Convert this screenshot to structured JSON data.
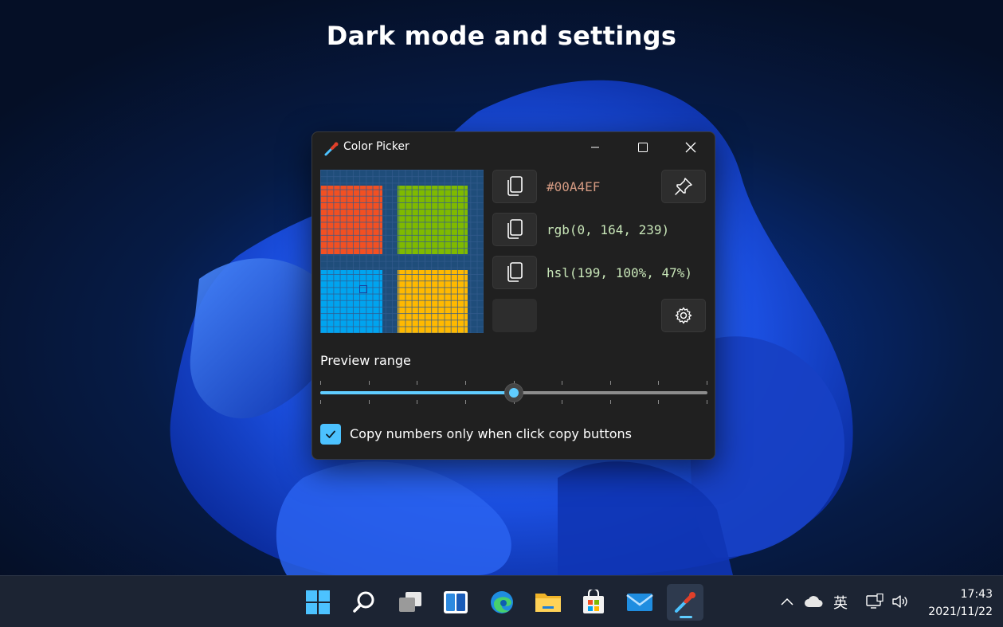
{
  "headline": "Dark mode and settings",
  "window": {
    "title": "Color Picker",
    "controls": {
      "minimize": "minimize",
      "maximize": "maximize",
      "close": "close"
    }
  },
  "colors": {
    "hex": "#00A4EF",
    "rgb": "rgb(0, 164, 239)",
    "hsl": "hsl(199, 100%, 47%)",
    "hex_text_color": "#d49a82",
    "value_text_color": "#c8e6b8",
    "accent": "#60cdff"
  },
  "preview": {
    "tile_colors": [
      "#f25022",
      "#7fba00",
      "#00a4ef",
      "#ffb900"
    ]
  },
  "preview_range": {
    "label": "Preview range",
    "value_fraction": 0.5
  },
  "option": {
    "label": "Copy numbers only when click copy buttons",
    "checked": true
  },
  "taskbar": {
    "apps": [
      "start",
      "search",
      "task-view",
      "widgets",
      "edge",
      "file-explorer",
      "microsoft-store",
      "mail",
      "color-picker"
    ],
    "ime": "英",
    "time": "17:43",
    "date": "2021/11/22"
  }
}
